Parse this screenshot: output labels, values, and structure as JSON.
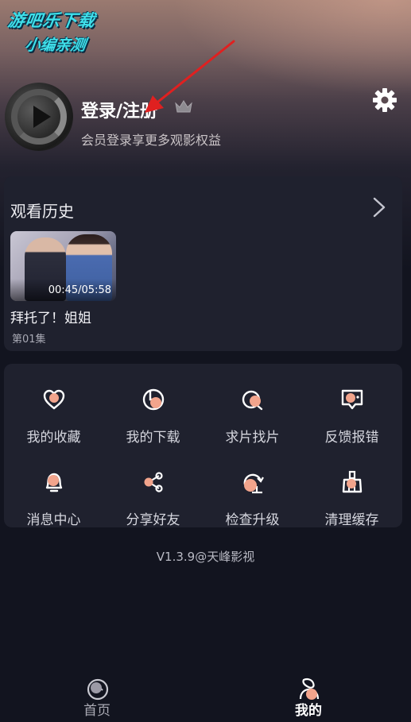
{
  "watermark": {
    "line1": "游吧乐下载",
    "line2": "小编亲测"
  },
  "profile": {
    "login_title": "登录/注册",
    "subtitle": "会员登录享更多观影权益",
    "avatar_icon": "film-reel-play-icon",
    "vip_icon": "crown-icon",
    "settings_icon": "gear-icon"
  },
  "history": {
    "title": "观看历史",
    "more_icon": "chevron-right-icon",
    "items": [
      {
        "name": "拜托了！姐姐",
        "episode": "第01集",
        "progress": "00:45/05:58"
      }
    ]
  },
  "menu": {
    "items": [
      {
        "label": "我的收藏",
        "icon": "heart-icon"
      },
      {
        "label": "我的下载",
        "icon": "download-icon"
      },
      {
        "label": "求片找片",
        "icon": "search-film-icon"
      },
      {
        "label": "反馈报错",
        "icon": "feedback-icon"
      },
      {
        "label": "消息中心",
        "icon": "bell-icon"
      },
      {
        "label": "分享好友",
        "icon": "share-icon"
      },
      {
        "label": "检查升级",
        "icon": "upgrade-icon"
      },
      {
        "label": "清理缓存",
        "icon": "broom-icon"
      }
    ]
  },
  "version": "V1.3.9@天峰影视",
  "tabbar": {
    "tabs": [
      {
        "label": "首页",
        "icon": "home-icon",
        "active": false
      },
      {
        "label": "我的",
        "icon": "user-icon",
        "active": true
      }
    ]
  },
  "colors": {
    "accent": "#f2a48c",
    "icon_stroke": "#ffffff",
    "card_bg": "#1f212e",
    "page_bg": "#12141f",
    "watermark": "#3fe0ea",
    "annotation_arrow": "#e02020"
  }
}
